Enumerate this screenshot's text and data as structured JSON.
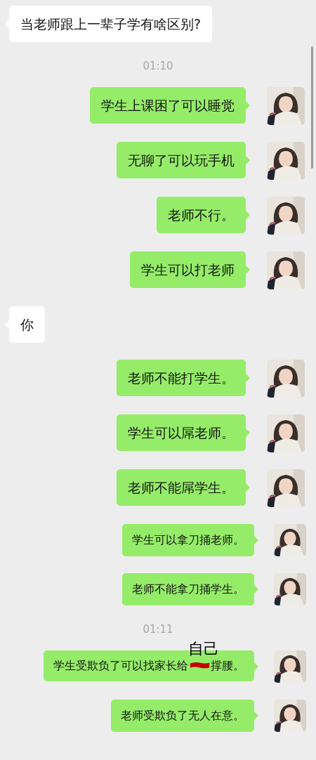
{
  "messages": [
    {
      "kind": "incoming",
      "text": "当老师跟上一辈子学有啥区别?"
    },
    {
      "kind": "time",
      "text": "01:10"
    },
    {
      "kind": "outgoing",
      "small": false,
      "text": "学生上课困了可以睡觉"
    },
    {
      "kind": "outgoing",
      "small": false,
      "text": "无聊了可以玩手机"
    },
    {
      "kind": "outgoing",
      "small": false,
      "text": "老师不行。"
    },
    {
      "kind": "outgoing",
      "small": false,
      "text": "学生可以打老师"
    },
    {
      "kind": "incoming",
      "text": "你"
    },
    {
      "kind": "outgoing",
      "small": false,
      "text": "老师不能打学生。"
    },
    {
      "kind": "outgoing",
      "small": false,
      "text": "学生可以屌老师。"
    },
    {
      "kind": "outgoing",
      "small": false,
      "text": "老师不能屌学生。"
    },
    {
      "kind": "outgoing",
      "small": true,
      "text": "学生可以拿刀捅老师。"
    },
    {
      "kind": "outgoing",
      "small": true,
      "text": "老师不能拿刀捅学生。"
    },
    {
      "kind": "time",
      "text": "01:11"
    },
    {
      "kind": "edited",
      "small": true,
      "text_before": "学生受欺负了可以找家长给",
      "annotation": "自己",
      "text_after": "撑腰。"
    },
    {
      "kind": "outgoing",
      "small": true,
      "text": "老师受欺负了无人在意。"
    }
  ]
}
